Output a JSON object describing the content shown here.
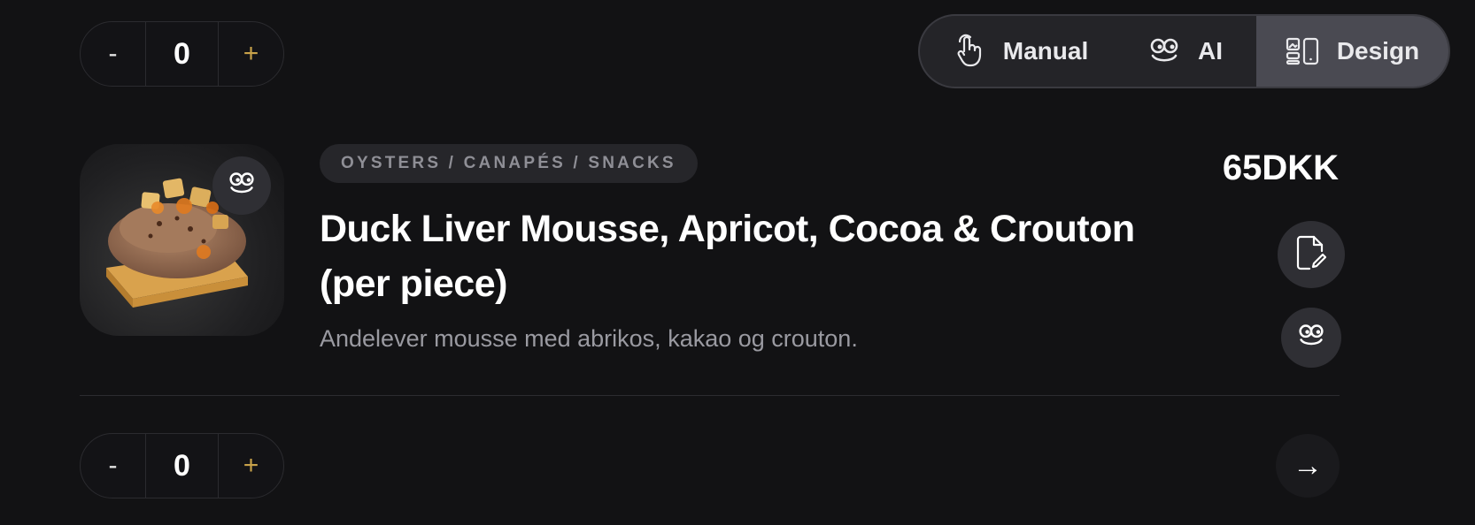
{
  "stepper_top": {
    "minus_label": "-",
    "value": "0",
    "plus_label": "+"
  },
  "mode_switch": {
    "tabs": [
      {
        "label": "Manual",
        "icon": "hand-pointer-icon"
      },
      {
        "label": "AI",
        "icon": "ai-face-icon"
      },
      {
        "label": "Design",
        "icon": "layout-device-icon",
        "selected": true
      }
    ]
  },
  "product": {
    "category": "OYSTERS / CANAPÉS / SNACKS",
    "price": "65DKK",
    "title": "Duck Liver Mousse, Apricot, Cocoa & Crouton (per piece)",
    "description": "Andelever mousse med abrikos, kakao og crouton.",
    "image_icon": "ai-face-icon",
    "actions": [
      {
        "icon": "document-edit-icon"
      },
      {
        "icon": "ai-face-icon"
      }
    ]
  },
  "stepper_bottom": {
    "minus_label": "-",
    "value": "0",
    "plus_label": "+"
  },
  "next_button": {
    "label": "→"
  },
  "colors": {
    "background": "#121214",
    "accent_plus": "#c8a24a",
    "selected_tab": "#4a4a52",
    "muted_text": "#9a9aa1"
  }
}
